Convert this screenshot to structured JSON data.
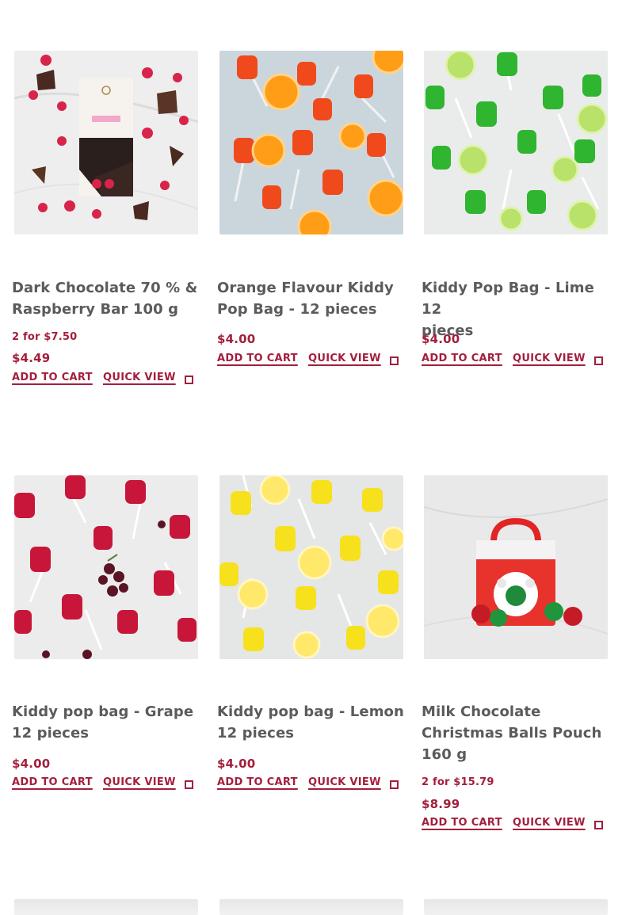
{
  "products": [
    {
      "title_line1": "Dark Chocolate 70 % &",
      "title_line2": "Raspberry Bar 100 g",
      "title_line3": "",
      "deal": "2 for $7.50",
      "price": "$4.49",
      "add_to_cart": "ADD TO CART",
      "quick_view": "QUICK VIEW",
      "image": "chocolate-raspberry"
    },
    {
      "title_line1": "Orange Flavour Kiddy",
      "title_line2": "Pop Bag - 12 pieces",
      "title_line3": "",
      "deal": "",
      "price": "$4.00",
      "add_to_cart": "ADD TO CART",
      "quick_view": "QUICK VIEW",
      "image": "orange-lollipops"
    },
    {
      "title_line1": "Kiddy Pop Bag - Lime 12",
      "title_line2": "pieces",
      "title_line3": "",
      "deal": "",
      "price": "$4.00",
      "add_to_cart": "ADD TO CART",
      "quick_view": "QUICK VIEW",
      "image": "lime-lollipops"
    },
    {
      "title_line1": "Kiddy pop bag - Grape",
      "title_line2": "12 pieces",
      "title_line3": "",
      "deal": "",
      "price": "$4.00",
      "add_to_cart": "ADD TO CART",
      "quick_view": "QUICK VIEW",
      "image": "grape-lollipops"
    },
    {
      "title_line1": "Kiddy pop bag - Lemon",
      "title_line2": "12 pieces",
      "title_line3": "",
      "deal": "",
      "price": "$4.00",
      "add_to_cart": "ADD TO CART",
      "quick_view": "QUICK VIEW",
      "image": "lemon-lollipops"
    },
    {
      "title_line1": "Milk Chocolate",
      "title_line2": "Christmas Balls Pouch",
      "title_line3": "160 g",
      "deal": "2 for $15.79",
      "price": "$8.99",
      "add_to_cart": "ADD TO CART",
      "quick_view": "QUICK VIEW",
      "image": "christmas-balls-pouch"
    }
  ],
  "colors": {
    "accent": "#a31f3c",
    "title": "#5b5b5b"
  }
}
